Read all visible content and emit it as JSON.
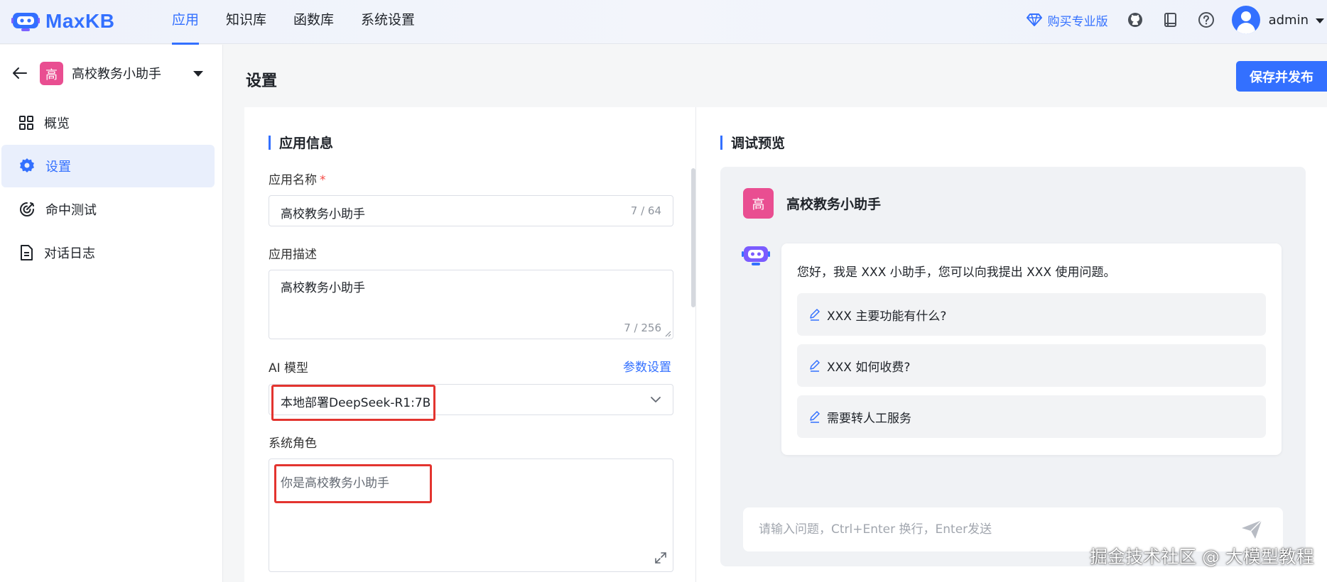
{
  "brand": {
    "name": "MaxKB"
  },
  "nav": {
    "items": [
      "应用",
      "知识库",
      "函数库",
      "系统设置"
    ],
    "active_index": 0
  },
  "header": {
    "buy_pro_label": "购买专业版",
    "user_name": "admin"
  },
  "sidebar": {
    "app_badge": "高",
    "app_name": "高校教务小助手",
    "items": [
      {
        "label": "概览",
        "icon": "grid-icon"
      },
      {
        "label": "设置",
        "icon": "gear-icon"
      },
      {
        "label": "命中测试",
        "icon": "target-icon"
      },
      {
        "label": "对话日志",
        "icon": "document-icon"
      }
    ],
    "active_index": 1
  },
  "main": {
    "title": "设置",
    "publish_label": "保存并发布"
  },
  "app_info": {
    "section_title": "应用信息",
    "name_label": "应用名称",
    "required_mark": "*",
    "name_value": "高校教务小助手",
    "name_count": "7 / 64",
    "desc_label": "应用描述",
    "desc_value": "高校教务小助手",
    "desc_count": "7 / 256",
    "model_label": "AI 模型",
    "param_link": "参数设置",
    "model_value": "本地部署DeepSeek-R1:7B",
    "role_label": "系统角色",
    "role_value": "你是高校教务小助手"
  },
  "preview": {
    "section_title": "调试预览",
    "app_badge": "高",
    "app_name": "高校教务小助手",
    "greeting": "您好，我是 XXX 小助手，您可以向我提出 XXX 使用问题。",
    "suggestions": [
      "XXX 主要功能有什么?",
      "XXX 如何收费?",
      "需要转人工服务"
    ],
    "input_placeholder": "请输入问题，Ctrl+Enter 换行，Enter发送"
  },
  "watermark": "掘金技术社区 @ 大模型教程",
  "colors": {
    "accent": "#3370ff",
    "app_badge": "#e94e91",
    "highlight_box": "#e3342f"
  }
}
